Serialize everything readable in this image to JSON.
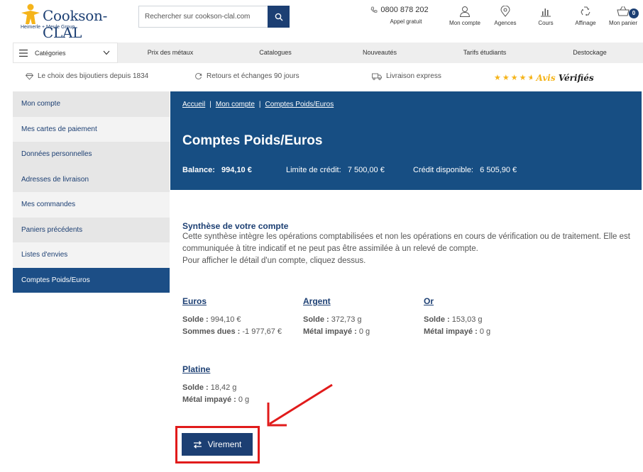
{
  "header": {
    "logo_text": "Cookson-CLAL",
    "logo_sub": "Heimerle + Meule Group",
    "search_placeholder": "Rechercher sur cookson-clal.com",
    "phone": "0800 878 202",
    "phone_sub": "Appel gratuit",
    "icons": [
      {
        "label": "Mon compte",
        "icon": "user-icon"
      },
      {
        "label": "Agences",
        "icon": "location-icon"
      },
      {
        "label": "Cours",
        "icon": "chart-icon"
      },
      {
        "label": "Affinage",
        "icon": "recycle-icon"
      },
      {
        "label": "Mon panier",
        "icon": "basket-icon"
      }
    ],
    "cart_count": "0"
  },
  "nav": {
    "categories": "Catégories",
    "items": [
      "Prix des métaux",
      "Catalogues",
      "Nouveautés",
      "Tarifs étudiants",
      "Destockage"
    ]
  },
  "benefits": {
    "items": [
      "Le choix des bijoutiers depuis 1834",
      "Retours et échanges 90 jours",
      "Livraison express"
    ],
    "avis_1": "Avis",
    "avis_2": "Vérifiés",
    "stars": 4.5
  },
  "sidebar": {
    "items": [
      "Mon compte",
      "Mes cartes de paiement",
      "Données personnelles",
      "Adresses de livraison",
      "Mes commandes",
      "Paniers précédents",
      "Listes d'envies",
      "Comptes Poids/Euros"
    ]
  },
  "banner": {
    "breadcrumb": [
      "Accueil",
      "Mon compte",
      "Comptes Poids/Euros"
    ],
    "title": "Comptes Poids/Euros",
    "balance_label": "Balance:",
    "balance_value": "994,10 €",
    "credit_label": "Limite de crédit:",
    "credit_value": "7 500,00 €",
    "available_label": "Crédit disponible:",
    "available_value": "6 505,90 €"
  },
  "synthese": {
    "title": "Synthèse de votre compte",
    "text1": "Cette synthèse intègre les opérations comptabilisées et non les opérations en cours de vérification ou de traitement. Elle est",
    "text2": "communiquée à titre indicatif et ne peut pas être assimilée à un relevé de compte.",
    "text3": "Pour afficher le détail d'un compte, cliquez dessus."
  },
  "accounts": [
    {
      "name": "Euros",
      "l1": "Solde :",
      "v1": " 994,10 €",
      "l2": "Sommes dues :",
      "v2": " -1 977,67 €"
    },
    {
      "name": "Argent",
      "l1": "Solde :",
      "v1": " 372,73 g",
      "l2": "Métal impayé :",
      "v2": " 0 g"
    },
    {
      "name": "Or",
      "l1": "Solde :",
      "v1": " 153,03 g",
      "l2": "Métal impayé :",
      "v2": " 0 g"
    },
    {
      "name": "Platine",
      "l1": "Solde :",
      "v1": " 18,42 g",
      "l2": "Métal impayé :",
      "v2": " 0 g"
    }
  ],
  "virement": "Virement",
  "colors": {
    "brand": "#1c3f73",
    "banner": "#174e83",
    "highlight": "#e11b1b",
    "star": "#f5b41a"
  }
}
